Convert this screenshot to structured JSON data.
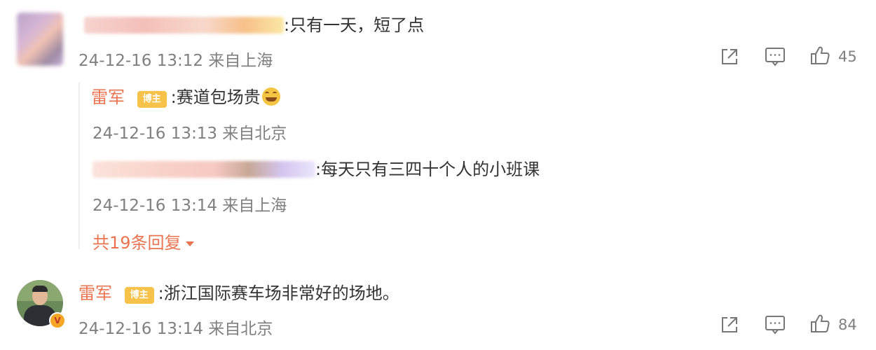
{
  "comment1": {
    "text": ":只有一天，短了点",
    "time": "24-12-16 13:12 来自上海",
    "likes": "45"
  },
  "reply1": {
    "name": "雷军",
    "badge": "博主",
    "text": ":赛道包场贵",
    "time": "24-12-16 13:13 来自北京"
  },
  "reply2": {
    "text": ":每天只有三四十个人的小班课",
    "time": "24-12-16 13:14 来自上海"
  },
  "more_replies": "共19条回复",
  "comment2": {
    "name": "雷军",
    "badge": "博主",
    "text": ":浙江国际赛车场非常好的场地。",
    "time": "24-12-16 13:14 来自北京",
    "likes": "84"
  },
  "colors": {
    "name": "#eb7350",
    "meta": "#808080",
    "badge": "#f6c24a"
  }
}
